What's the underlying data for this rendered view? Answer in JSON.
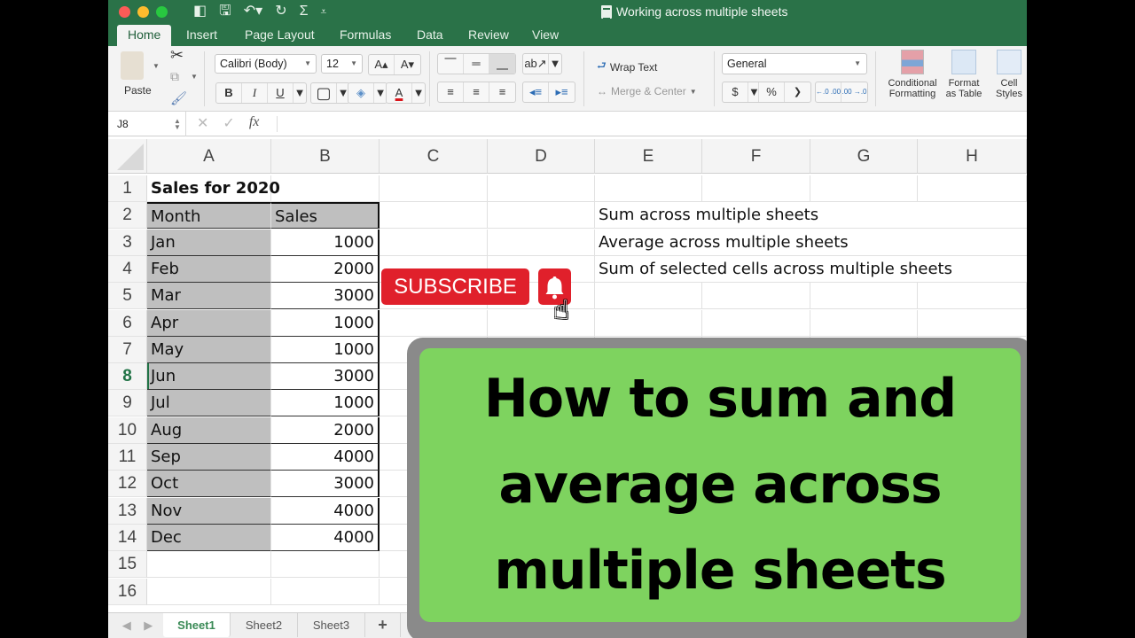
{
  "window": {
    "title": "Working across multiple sheets",
    "traffic_lights": {
      "close": "#fc5b57",
      "minimize": "#fdbc2e",
      "zoom": "#28c840"
    }
  },
  "quick_access": [
    {
      "name": "sidebar-toggle-icon",
      "glyph": "◧"
    },
    {
      "name": "save-icon",
      "glyph": "🖫"
    },
    {
      "name": "undo-icon",
      "glyph": "↶▾"
    },
    {
      "name": "redo-icon",
      "glyph": "↻"
    },
    {
      "name": "autosum-icon",
      "glyph": "Σ"
    },
    {
      "name": "customize-toolbar-icon",
      "glyph": "⩡"
    }
  ],
  "tabs": [
    "Home",
    "Insert",
    "Page Layout",
    "Formulas",
    "Data",
    "Review",
    "View"
  ],
  "active_tab": "Home",
  "ribbon": {
    "paste_label": "Paste",
    "font_name": "Calibri (Body)",
    "font_size": "12",
    "grow_font": "A▴",
    "shrink_font": "A▾",
    "bold": "B",
    "italic": "I",
    "underline": "U",
    "wrap_text": "Wrap Text",
    "merge_center": "Merge & Center",
    "number_format": "General",
    "currency": "$",
    "percent": "%",
    "comma": "❯",
    "increase_decimal": "←.0 .00",
    "decrease_decimal": ".00 →.0",
    "conditional_formatting": [
      "Conditional",
      "Formatting"
    ],
    "format_as_table": [
      "Format",
      "as Table"
    ],
    "cell_styles": [
      "Cell",
      "Styles"
    ],
    "font_color": "#d9151b"
  },
  "formula_bar": {
    "name_box": "J8",
    "cancel": "✕",
    "enter": "✓",
    "fx": "fx",
    "formula": ""
  },
  "columns": [
    "A",
    "B",
    "C",
    "D",
    "E",
    "F",
    "G",
    "H"
  ],
  "rows": [
    "1",
    "2",
    "3",
    "4",
    "5",
    "6",
    "7",
    "8",
    "9",
    "10",
    "11",
    "12",
    "13",
    "14",
    "15",
    "16"
  ],
  "selected_row": "8",
  "sheet": {
    "title": "Sales for 2020",
    "header": {
      "month": "Month",
      "sales": "Sales"
    },
    "data": [
      {
        "month": "Jan",
        "sales": "1000"
      },
      {
        "month": "Feb",
        "sales": "2000"
      },
      {
        "month": "Mar",
        "sales": "3000"
      },
      {
        "month": "Apr",
        "sales": "1000"
      },
      {
        "month": "May",
        "sales": "1000"
      },
      {
        "month": "Jun",
        "sales": "3000"
      },
      {
        "month": "Jul",
        "sales": "1000"
      },
      {
        "month": "Aug",
        "sales": "2000"
      },
      {
        "month": "Sep",
        "sales": "4000"
      },
      {
        "month": "Oct",
        "sales": "3000"
      },
      {
        "month": "Nov",
        "sales": "4000"
      },
      {
        "month": "Dec",
        "sales": "4000"
      }
    ],
    "notes": [
      "Sum across multiple sheets",
      "Average across multiple sheets",
      "Sum of selected cells across multiple sheets"
    ]
  },
  "sheet_tabs": [
    "Sheet1",
    "Sheet2",
    "Sheet3"
  ],
  "active_sheet": "Sheet1",
  "add_sheet": "+",
  "overlay": {
    "subscribe_label": "SUBSCRIBE",
    "banner_lines": [
      "How to sum and",
      "average across",
      "multiple sheets"
    ],
    "subscribe_color": "#e0202b",
    "banner_color": "#7ed35f"
  }
}
